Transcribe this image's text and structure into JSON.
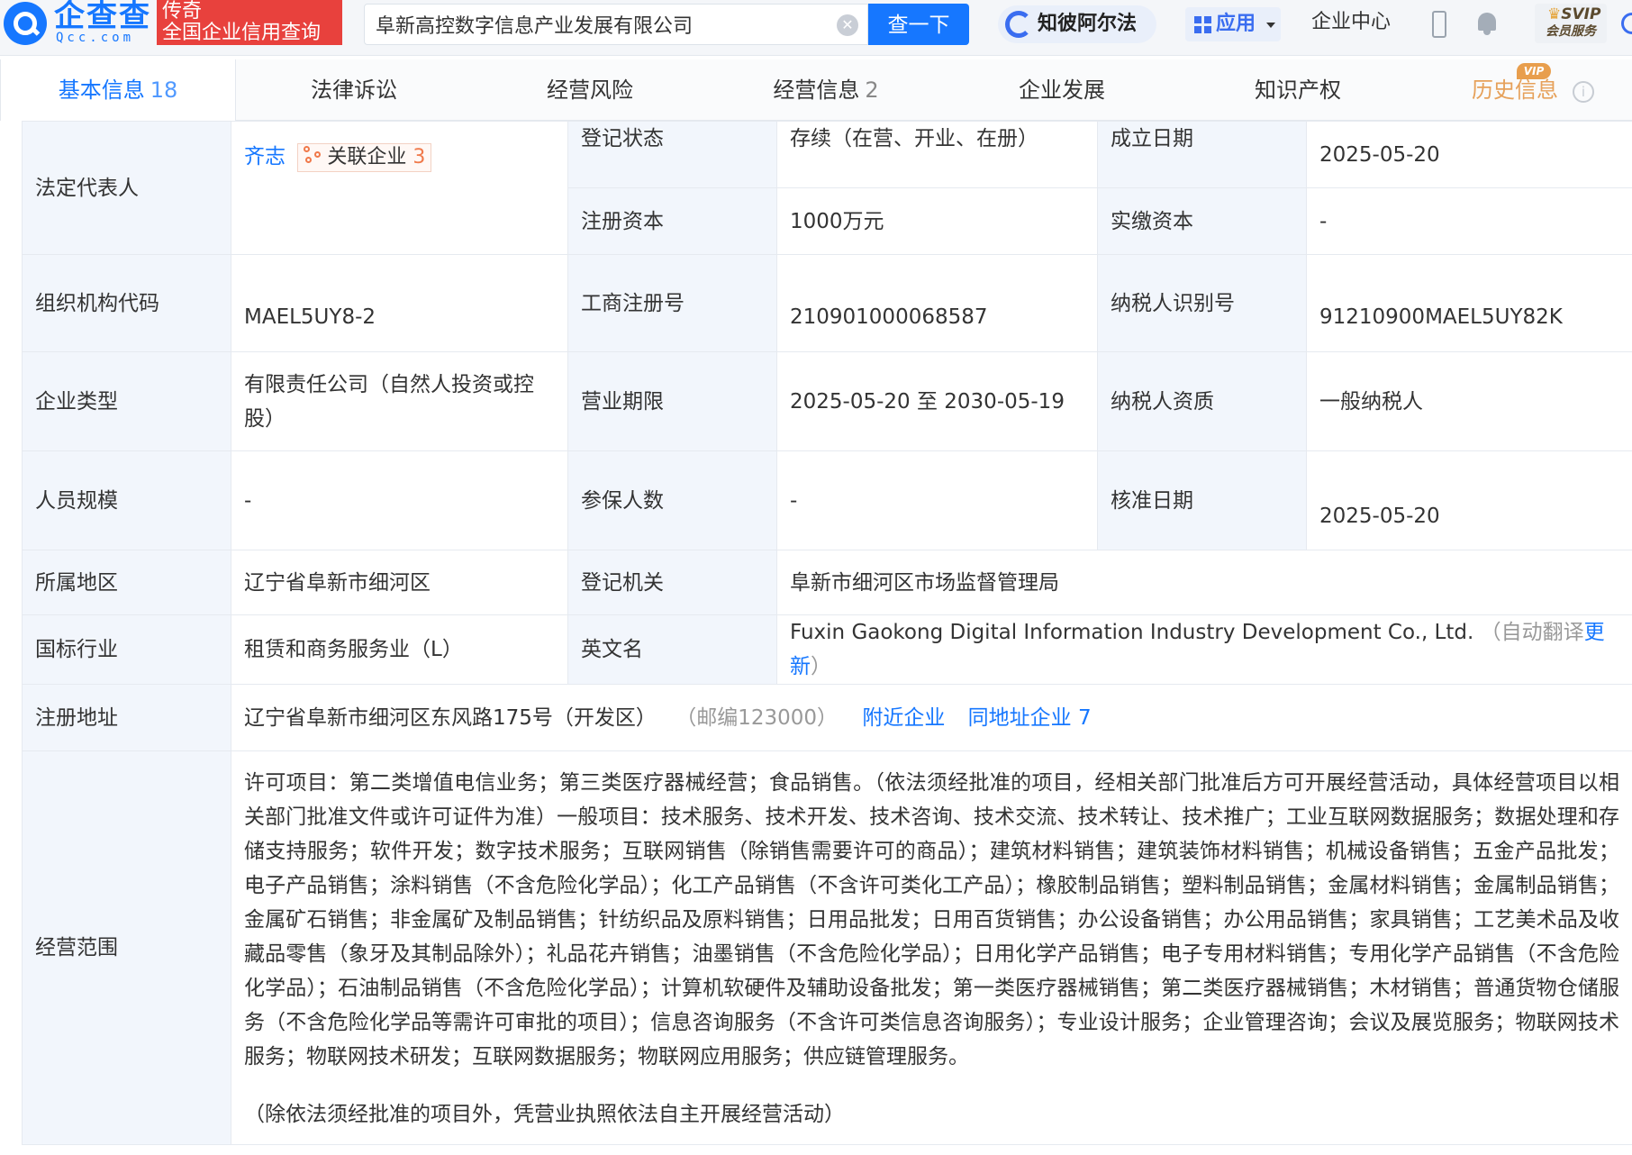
{
  "header": {
    "logo_name": "企查查",
    "logo_domain": "Qcc.com",
    "slogan_line1": "传奇",
    "slogan_line2": "全国企业信用查询",
    "search_value": "阜新高控数字信息产业发展有限公司",
    "search_button": "查一下",
    "ai_label": "知彼阿尔法",
    "apps_label": "应用",
    "enterprise_center": "企业中心",
    "svip_top": "SVIP",
    "svip_bottom": "会员服务"
  },
  "tabs": [
    {
      "label": "基本信息",
      "count": "18"
    },
    {
      "label": "法律诉讼",
      "count": ""
    },
    {
      "label": "经营风险",
      "count": ""
    },
    {
      "label": "经营信息",
      "count": "2"
    },
    {
      "label": "企业发展",
      "count": ""
    },
    {
      "label": "知识产权",
      "count": ""
    },
    {
      "label": "历史信息",
      "count": ""
    }
  ],
  "vip_badge": "VIP",
  "info": {
    "legal_rep_label": "法定代表人",
    "legal_rep_name": "齐志",
    "related_label": "关联企业",
    "related_count": "3",
    "reg_status_label": "登记状态",
    "reg_status": "存续（在营、开业、在册）",
    "found_date_label": "成立日期",
    "found_date": "2025-05-20",
    "reg_capital_label": "注册资本",
    "reg_capital": "1000万元",
    "paid_capital_label": "实缴资本",
    "paid_capital": "-",
    "org_code_label": "组织机构代码",
    "org_code": "MAEL5UY8-2",
    "biz_reg_no_label": "工商注册号",
    "biz_reg_no": "210901000068587",
    "taxpayer_id_label": "纳税人识别号",
    "taxpayer_id": "91210900MAEL5UY82K",
    "ent_type_label": "企业类型",
    "ent_type": "有限责任公司（自然人投资或控股）",
    "biz_term_label": "营业期限",
    "biz_term": "2025-05-20 至 2030-05-19",
    "tax_qual_label": "纳税人资质",
    "tax_qual": "一般纳税人",
    "staff_size_label": "人员规模",
    "staff_size": "-",
    "insured_label": "参保人数",
    "insured": "-",
    "approve_date_label": "核准日期",
    "approve_date": "2025-05-20",
    "region_label": "所属地区",
    "region": "辽宁省阜新市细河区",
    "reg_authority_label": "登记机关",
    "reg_authority": "阜新市细河区市场监督管理局",
    "industry_label": "国标行业",
    "industry": "租赁和商务服务业（L）",
    "english_name_label": "英文名",
    "english_name": "Fuxin Gaokong Digital Information Industry Development Co., Ltd.",
    "auto_translate_prefix": "（自动翻译",
    "auto_translate_update": "更新",
    "auto_translate_suffix": "）",
    "address_label": "注册地址",
    "address": "辽宁省阜新市细河区东风路175号（开发区）",
    "postcode": "（邮编123000）",
    "nearby_link": "附近企业",
    "same_address_link": "同地址企业",
    "same_address_count": "7",
    "scope_label": "经营范围",
    "scope_part1": "许可项目：第二类增值电信业务；第三类医疗器械经营；食品销售。（依法须经批准的项目，经相关部门批准后方可开展经营活动，具体经营项目以相关部门批准文件或许可证件为准）一般项目：技术服务、技术开发、技术咨询、技术交流、技术转让、技术推广；工业互联网数据服务；数据处理和存储支持服务；软件开发；数字技术服务；互联网销售（除销售需要许可的商品）；建筑材料销售；建筑装饰材料销售；机械设备销售；五金产品批发；电子产品销售；涂料销售（不含危险化学品）；化工产品销售（不含许可类化工产品）；橡胶制品销售；塑料制品销售；金属材料销售；金属制品销售；金属矿石销售；非金属矿及制品销售；针纺织品及原料销售；日用品批发；日用百货销售；办公设备销售；办公用品销售；家具销售；工艺美术品及收藏品零售（象牙及其制品除外）；礼品花卉销售；油墨销售（不含危险化学品）；日用化学产品销售；电子专用材料销售；专用化学产品销售（不含危险化学品）；石油制品销售（不含危险化学品）；计算机软硬件及辅助设备批发；第一类医疗器械销售；第二类医疗器械销售；木材销售；普通货物仓储服务（不含危险化学品等需许可审批的项目）；信息咨询服务（不含许可类信息咨询服务）；专业设计服务；企业管理咨询；会议及展览服务；物联网技术服务；物联网技术研发；互联网数据服务；物联网应用服务；供应链管理服务。",
    "scope_part2": "（除依法须经批准的项目外，凭营业执照依法自主开展经营活动）"
  }
}
